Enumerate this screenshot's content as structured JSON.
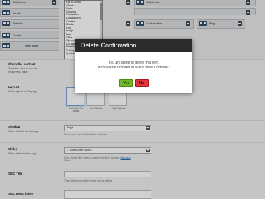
{
  "builder": {
    "modules": [
      {
        "label": "Article box"
      },
      {
        "label": "Article box"
      },
      {
        "label": "Divider"
      },
      {
        "label": "Portfolio"
      },
      {
        "label": "Contact form"
      },
      {
        "label": "Blog"
      },
      {
        "label": "Divider"
      },
      {
        "label": "Offer slider"
      }
    ],
    "dropdown_items": [
      "Call to action",
      "Clients",
      "Code",
      "Columns",
      "Contact box",
      "Contact form",
      "Content",
      "Divider",
      "FAQ",
      "Image",
      "Map",
      "Offer",
      "Opening",
      "Our team",
      "Portfolio",
      "Pricing",
      "Quick fact"
    ]
  },
  "form": {
    "show_content": {
      "title": "Show the content",
      "desc_line1": "Show the content from the",
      "desc_line2": "WordPress editor"
    },
    "layout": {
      "title": "Layout",
      "desc": "Select layout for this page",
      "options": [
        {
          "line1": "Full width. No",
          "line2": "sidebar"
        },
        {
          "line1": "Left Sidebar",
          "line2": ""
        },
        {
          "line1": "Right Sidebar",
          "line2": ""
        }
      ]
    },
    "sidebar": {
      "title": "Sidebar",
      "desc": "Select sidebar for this page",
      "value": "Page",
      "hint": "Shows only if layout with sidebar is selected"
    },
    "slider": {
      "title": "Slider",
      "desc": "Select slider for this page",
      "value": "-- Muffin Offer Slider --",
      "hint_line1": "Select Muffin Offer Slider or one from the list of available",
      "hint_link": "Revolution",
      "hint_line2": "Sliders"
    },
    "seo_title": {
      "title": "SEO Title",
      "hint": "These settings overriddes theme options settings"
    },
    "seo_description": {
      "title": "SEO Description"
    }
  },
  "modal": {
    "title": "Delete Confirmation",
    "line1": "You are about to delete this item.",
    "line2": "It cannot be restored at a later time! Continue?",
    "yes_label": "Yes",
    "no_label": "No"
  }
}
